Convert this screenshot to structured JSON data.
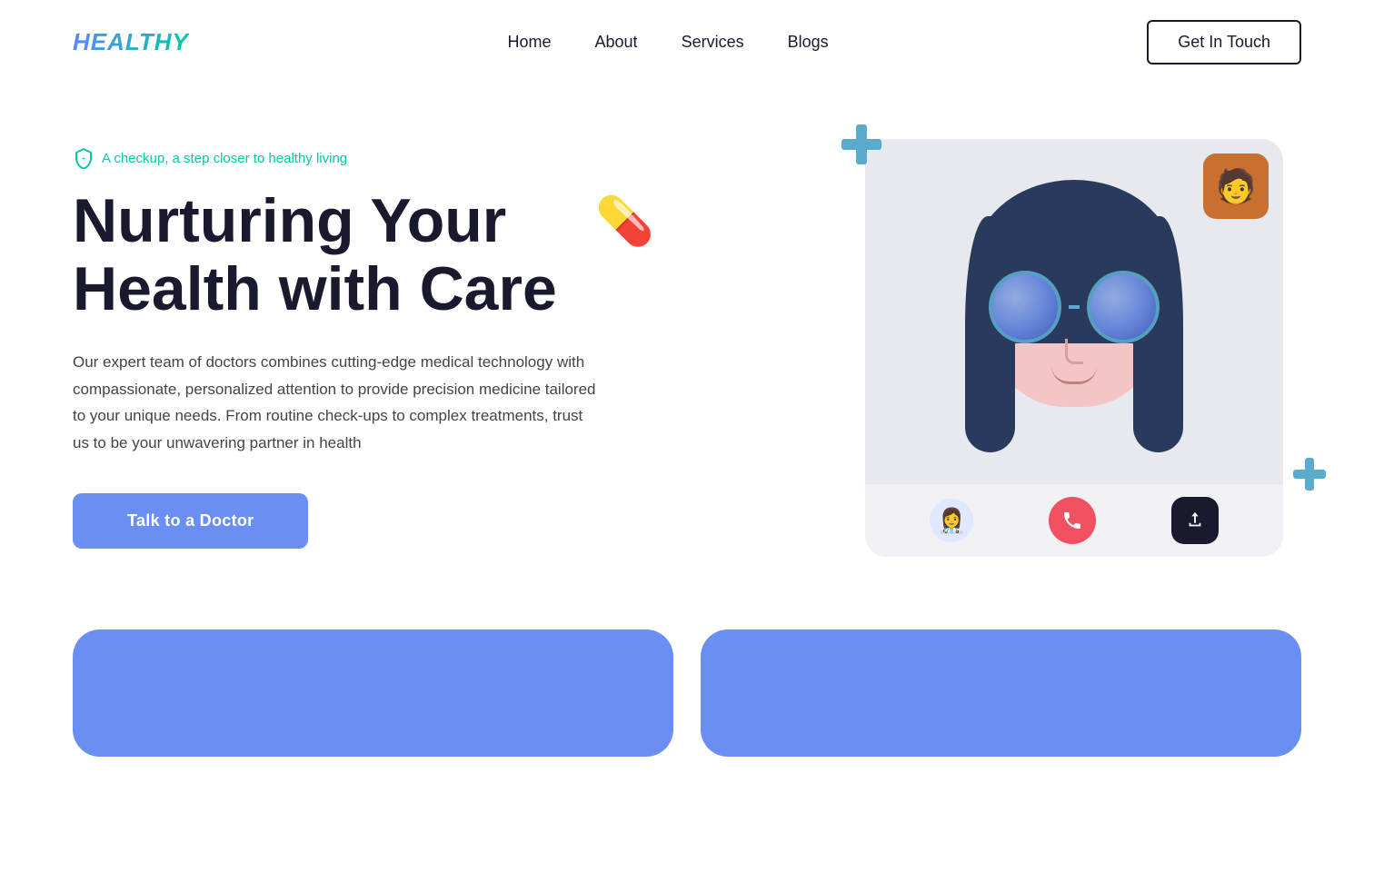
{
  "logo": "HEALTHY",
  "nav": {
    "links": [
      {
        "label": "Home",
        "id": "home"
      },
      {
        "label": "About",
        "id": "about"
      },
      {
        "label": "Services",
        "id": "services"
      },
      {
        "label": "Blogs",
        "id": "blogs"
      }
    ],
    "cta": "Get In Touch"
  },
  "hero": {
    "tagline": "A checkup, a step closer to healthy living",
    "title_line1": "Nurturing Your",
    "title_line2": "Health with Care",
    "description": "Our expert team of doctors combines cutting-edge medical technology with compassionate, personalized attention to provide precision medicine tailored to your unique needs. From routine check-ups to complex treatments, trust us to be your unwavering partner in health",
    "cta_button": "Talk to a Doctor",
    "pill_emoji": "💊"
  },
  "video_call": {
    "end_call_icon": "📞",
    "share_icon": "⬆",
    "plus_symbol": "+"
  },
  "colors": {
    "brand_blue": "#6b8ef5",
    "brand_teal": "#00c9a7",
    "plus_color": "#5aabcc",
    "dark": "#1a1a2e"
  }
}
